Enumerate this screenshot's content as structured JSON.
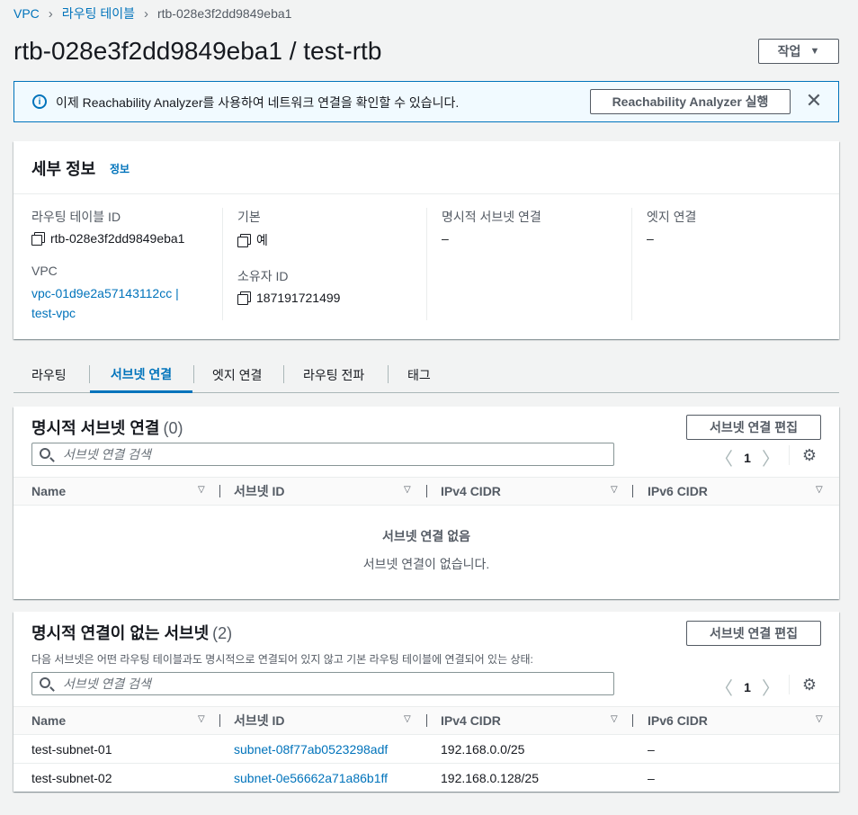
{
  "breadcrumb": {
    "items": [
      "VPC",
      "라우팅 테이블",
      "rtb-028e3f2dd9849eba1"
    ]
  },
  "page": {
    "title": "rtb-028e3f2dd9849eba1 / test-rtb",
    "actions_label": "작업"
  },
  "flash": {
    "message": "이제 Reachability Analyzer를 사용하여 네트워크 연결을 확인할 수 있습니다.",
    "run_button": "Reachability Analyzer 실행",
    "close": "✕"
  },
  "details": {
    "title": "세부 정보",
    "info_link": "정보",
    "route_table_id_label": "라우팅 테이블 ID",
    "route_table_id": "rtb-028e3f2dd9849eba1",
    "vpc_label": "VPC",
    "vpc_link_line1": "vpc-01d9e2a57143112cc |",
    "vpc_link_line2": "test-vpc",
    "main_label": "기본",
    "main_value": "예",
    "owner_label": "소유자 ID",
    "owner_value": "187191721499",
    "explicit_label": "명시적 서브넷 연결",
    "explicit_value": "–",
    "edge_label": "엣지 연결",
    "edge_value": "–"
  },
  "tabs": [
    "라우팅",
    "서브넷 연결",
    "엣지 연결",
    "라우팅 전파",
    "태그"
  ],
  "explicit_table": {
    "title": "명시적 서브넷 연결",
    "count": "(0)",
    "edit_button": "서브넷 연결 편집",
    "search_placeholder": "서브넷 연결 검색",
    "page": "1",
    "columns": [
      "Name",
      "서브넷 ID",
      "IPv4 CIDR",
      "IPv6 CIDR"
    ],
    "empty_title": "서브넷 연결 없음",
    "empty_sub": "서브넷 연결이 없습니다."
  },
  "implicit_table": {
    "title": "명시적 연결이 없는 서브넷",
    "count": "(2)",
    "description": "다음 서브넷은 어떤 라우팅 테이블과도 명시적으로 연결되어 있지 않고 기본 라우팅 테이블에 연결되어 있는 상태:",
    "edit_button": "서브넷 연결 편집",
    "search_placeholder": "서브넷 연결 검색",
    "page": "1",
    "columns": [
      "Name",
      "서브넷 ID",
      "IPv4 CIDR",
      "IPv6 CIDR"
    ],
    "rows": [
      {
        "name": "test-subnet-01",
        "subnet_id": "subnet-08f77ab0523298adf",
        "ipv4": "192.168.0.0/25",
        "ipv6": "–"
      },
      {
        "name": "test-subnet-02",
        "subnet_id": "subnet-0e56662a71a86b1ff",
        "ipv4": "192.168.0.128/25",
        "ipv6": "–"
      }
    ]
  },
  "icons": {
    "prev": "〈",
    "next": "〉",
    "sort": "▽",
    "caret": "▼",
    "gear": "⚙",
    "info": "i"
  }
}
